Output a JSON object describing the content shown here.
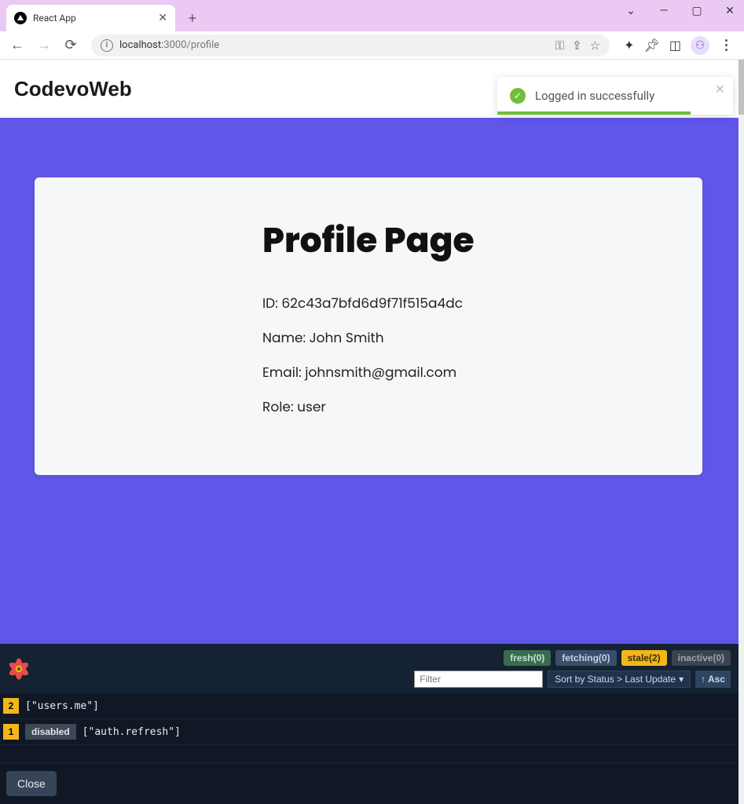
{
  "browser": {
    "tab_title": "React App",
    "url_host": "localhost:",
    "url_port_path": "3000/profile"
  },
  "header": {
    "brand": "CodevoWeb"
  },
  "toast": {
    "message": "Logged in successfully"
  },
  "profile": {
    "title": "Profile Page",
    "id_label": "ID: ",
    "id": "62c43a7bfd6d9f71f515a4dc",
    "name_label": "Name: ",
    "name": "John Smith",
    "email_label": "Email: ",
    "email": "johnsmith@gmail.com",
    "role_label": "Role: ",
    "role": "user"
  },
  "devtools": {
    "status": {
      "fresh": "fresh(0)",
      "fetching": "fetching(0)",
      "stale": "stale(2)",
      "inactive": "inactive(0)"
    },
    "filter_placeholder": "Filter",
    "sort_label": "Sort by Status > Last Update",
    "asc_label": "↑ Asc",
    "queries": [
      {
        "count": "2",
        "disabled": false,
        "key": "[\"users.me\"]"
      },
      {
        "count": "1",
        "disabled": true,
        "disabled_label": "disabled",
        "key": "[\"auth.refresh\"]"
      }
    ],
    "close_label": "Close"
  }
}
